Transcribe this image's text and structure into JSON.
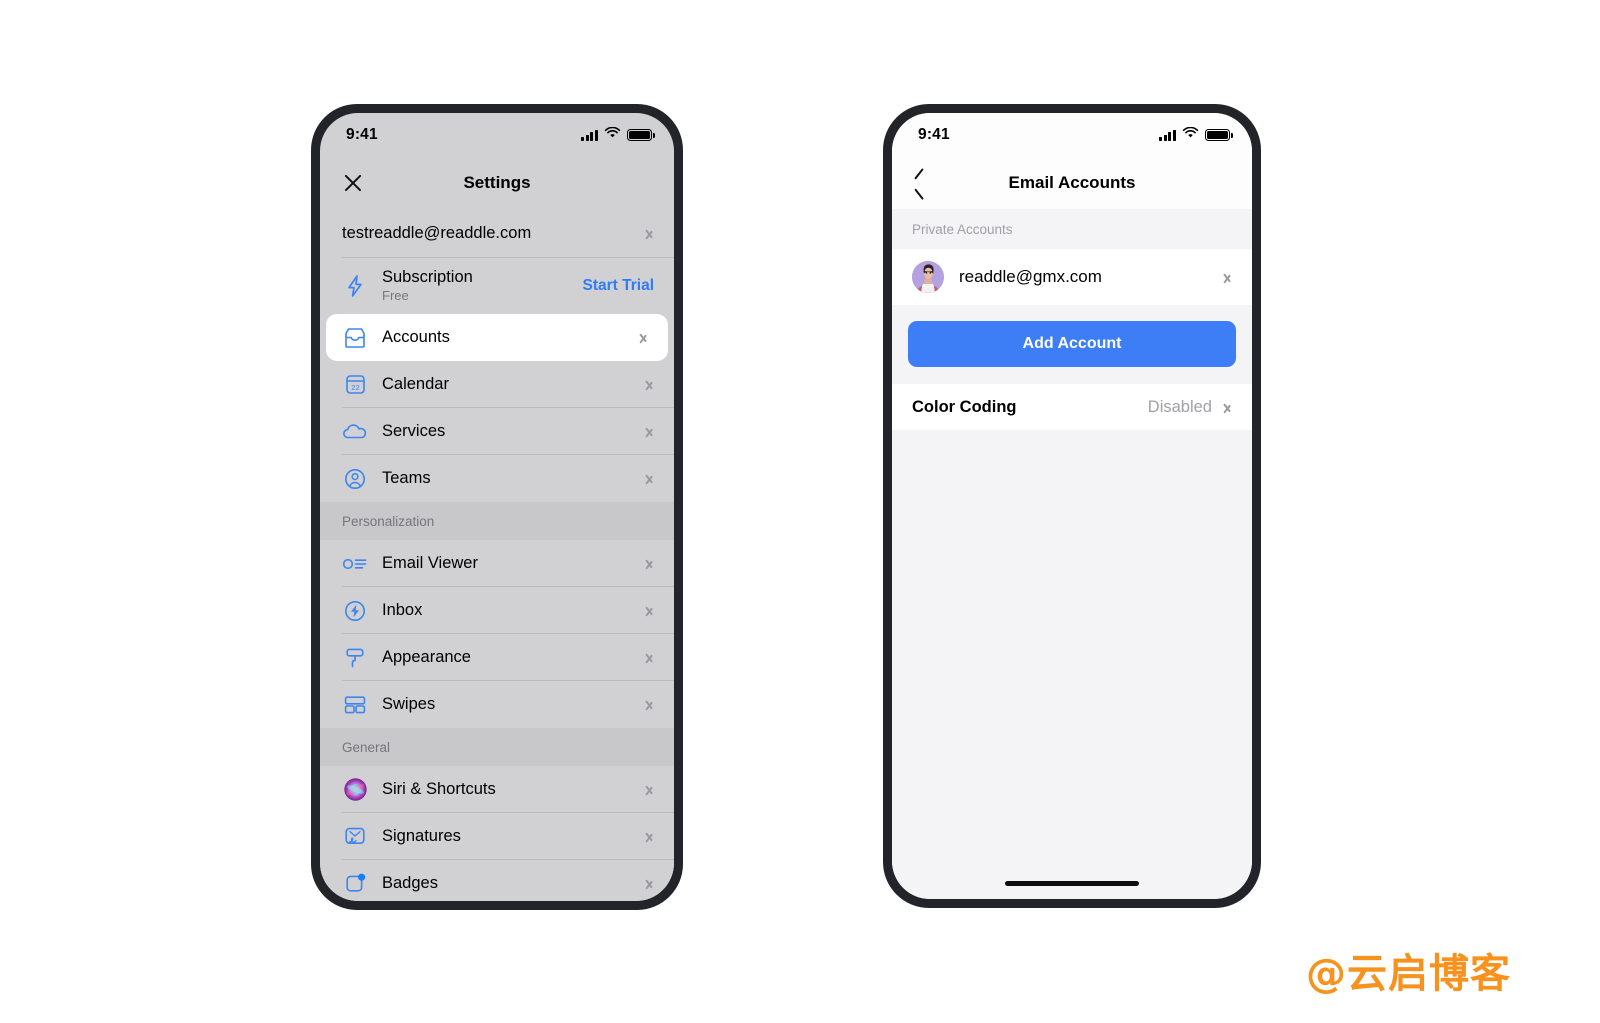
{
  "colors": {
    "accent_blue": "#3d7df5",
    "link_blue": "#2f7cf6",
    "icon_blue": "#3d85f0",
    "screen_bg_left": "#d1d1d3",
    "screen_bg_right": "#f4f4f6",
    "frame": "#22242a",
    "muted_text": "#a0a0a6",
    "watermark_orange": "#f7921e"
  },
  "watermark": {
    "text": "@云启博客"
  },
  "left_phone": {
    "status_bar": {
      "time": "9:41",
      "icons": [
        "cellular-signal-icon",
        "wifi-icon",
        "battery-icon"
      ]
    },
    "navbar": {
      "close_icon": "close-icon",
      "title": "Settings"
    },
    "account_row": {
      "label": "testreaddle@readdle.com",
      "chevron": "chevron-right-icon"
    },
    "subscription_row": {
      "icon": "bolt-icon",
      "title": "Subscription",
      "subtitle": "Free",
      "action": "Start Trial"
    },
    "groups": [
      {
        "header": null,
        "items": [
          {
            "label": "Accounts",
            "icon": "inbox-tray-icon",
            "selected": true
          },
          {
            "label": "Calendar",
            "icon": "calendar-icon",
            "selected": false
          },
          {
            "label": "Services",
            "icon": "cloud-icon",
            "selected": false
          },
          {
            "label": "Teams",
            "icon": "person-circle-icon",
            "selected": false
          }
        ]
      },
      {
        "header": "Personalization",
        "items": [
          {
            "label": "Email Viewer",
            "icon": "email-viewer-icon",
            "selected": false
          },
          {
            "label": "Inbox",
            "icon": "bolt-circle-icon",
            "selected": false
          },
          {
            "label": "Appearance",
            "icon": "paint-roller-icon",
            "selected": false
          },
          {
            "label": "Swipes",
            "icon": "swipes-icon",
            "selected": false
          }
        ]
      },
      {
        "header": "General",
        "items": [
          {
            "label": "Siri & Shortcuts",
            "icon": "siri-orb-icon",
            "selected": false
          },
          {
            "label": "Signatures",
            "icon": "signature-icon",
            "selected": false
          },
          {
            "label": "Badges",
            "icon": "badge-dot-icon",
            "selected": false
          }
        ]
      }
    ]
  },
  "right_phone": {
    "status_bar": {
      "time": "9:41",
      "icons": [
        "cellular-signal-icon",
        "wifi-icon",
        "battery-icon"
      ]
    },
    "navbar": {
      "back_icon": "chevron-left-icon",
      "title": "Email Accounts"
    },
    "section_header": "Private Accounts",
    "account": {
      "email": "readdle@gmx.com",
      "avatar": "user-avatar",
      "chevron": "chevron-right-icon"
    },
    "add_account_button": "Add Account",
    "color_coding": {
      "label": "Color Coding",
      "value": "Disabled",
      "chevron": "chevron-right-icon"
    },
    "home_indicator": "home-indicator"
  }
}
